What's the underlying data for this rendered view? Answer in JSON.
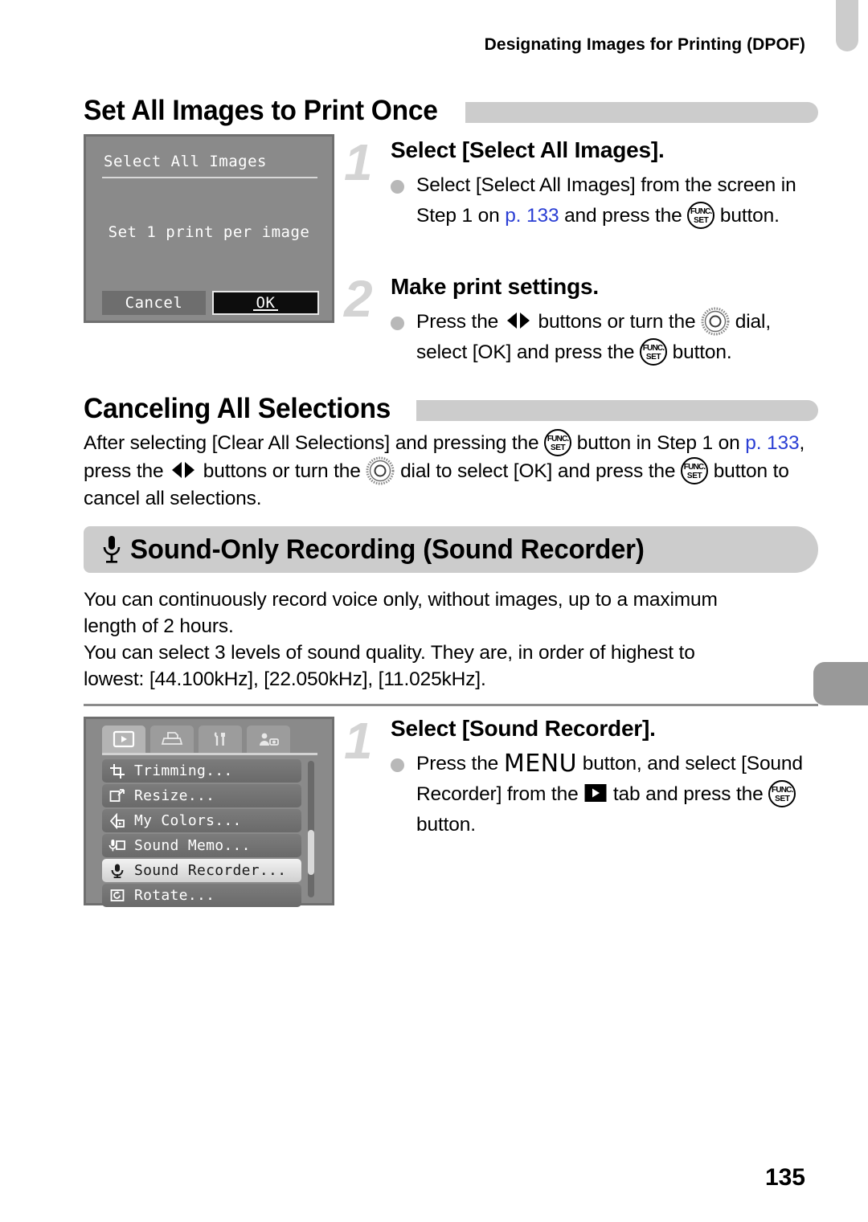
{
  "header": {
    "running_title": "Designating Images for Printing (DPOF)"
  },
  "page_number": "135",
  "colors": {
    "link": "#2b3fd4",
    "heading_bar": "#cccccc",
    "banner_bg": "#cccccc",
    "step_number": "#d4d4d4",
    "lcd_bg": "#8a8a8a",
    "edge_tab_top": "#cccccc",
    "edge_tab_side": "#999999"
  },
  "section_set_all": {
    "heading": "Set All Images to Print Once",
    "lcd": {
      "title": "Select All Images",
      "message": "Set 1 print per image",
      "buttons": [
        {
          "label": "Cancel",
          "selected": false
        },
        {
          "label": "OK",
          "selected": true
        }
      ]
    },
    "steps": [
      {
        "number": "1",
        "title": "Select [Select All Images].",
        "body_parts": [
          {
            "type": "text",
            "value": "Select [Select All Images] from the screen in Step 1 on "
          },
          {
            "type": "link",
            "value": "p. 133"
          },
          {
            "type": "text",
            "value": " and press the "
          },
          {
            "type": "icon",
            "value": "func-set-icon"
          },
          {
            "type": "text",
            "value": " button."
          }
        ]
      },
      {
        "number": "2",
        "title": "Make print settings.",
        "body_parts": [
          {
            "type": "text",
            "value": "Press the "
          },
          {
            "type": "icon",
            "value": "left-right-buttons-icon"
          },
          {
            "type": "text",
            "value": " buttons or turn the "
          },
          {
            "type": "icon",
            "value": "control-dial-icon"
          },
          {
            "type": "text",
            "value": " dial, select [OK] and press the "
          },
          {
            "type": "icon",
            "value": "func-set-icon"
          },
          {
            "type": "text",
            "value": " button."
          }
        ]
      }
    ]
  },
  "section_canceling": {
    "heading": "Canceling All Selections",
    "body_parts": [
      {
        "type": "text",
        "value": "After selecting [Clear All Selections] and pressing the "
      },
      {
        "type": "icon",
        "value": "func-set-icon"
      },
      {
        "type": "text",
        "value": " button in Step 1 on "
      },
      {
        "type": "link",
        "value": "p. 133"
      },
      {
        "type": "text",
        "value": ", press the "
      },
      {
        "type": "icon",
        "value": "left-right-buttons-icon"
      },
      {
        "type": "text",
        "value": " buttons or turn the "
      },
      {
        "type": "icon",
        "value": "control-dial-icon"
      },
      {
        "type": "text",
        "value": " dial to select [OK] and press the "
      },
      {
        "type": "icon",
        "value": "func-set-icon"
      },
      {
        "type": "text",
        "value": " button to cancel all selections."
      }
    ]
  },
  "section_sound_recorder": {
    "banner_icon": "microphone-icon",
    "banner_title": "Sound-Only Recording (Sound Recorder)",
    "intro_line_1": "You can continuously record voice only, without images, up to a maximum",
    "intro_line_2": "length of 2 hours.",
    "intro_line_3": "You can select 3 levels of sound quality. They are, in order of highest to",
    "intro_line_4": "lowest: [44.100kHz], [22.050kHz], [11.025kHz].",
    "lcd": {
      "tabs": [
        {
          "name": "playback-tab",
          "icon": "play-triangle-icon",
          "active": true
        },
        {
          "name": "print-tab",
          "icon": "printer-icon",
          "active": false
        },
        {
          "name": "settings-tab",
          "icon": "tools-icon",
          "active": false
        },
        {
          "name": "my-camera-tab",
          "icon": "person-camera-icon",
          "active": false
        }
      ],
      "items": [
        {
          "label": "Trimming...",
          "icon": "crop-icon",
          "selected": false
        },
        {
          "label": "Resize...",
          "icon": "resize-icon",
          "selected": false
        },
        {
          "label": "My Colors...",
          "icon": "my-colors-icon",
          "selected": false
        },
        {
          "label": "Sound Memo...",
          "icon": "sound-memo-icon",
          "selected": false
        },
        {
          "label": "Sound Recorder...",
          "icon": "microphone-icon",
          "selected": true
        },
        {
          "label": "Rotate...",
          "icon": "rotate-icon",
          "selected": false
        }
      ]
    },
    "steps": [
      {
        "number": "1",
        "title": "Select [Sound Recorder].",
        "body_parts": [
          {
            "type": "text",
            "value": "Press the "
          },
          {
            "type": "icon",
            "value": "menu-button-word"
          },
          {
            "type": "text",
            "value": " button, and select [Sound Recorder] from the "
          },
          {
            "type": "icon",
            "value": "play-tab-icon"
          },
          {
            "type": "text",
            "value": " tab and press the "
          },
          {
            "type": "icon",
            "value": "func-set-icon"
          },
          {
            "type": "text",
            "value": " button."
          }
        ]
      }
    ]
  }
}
